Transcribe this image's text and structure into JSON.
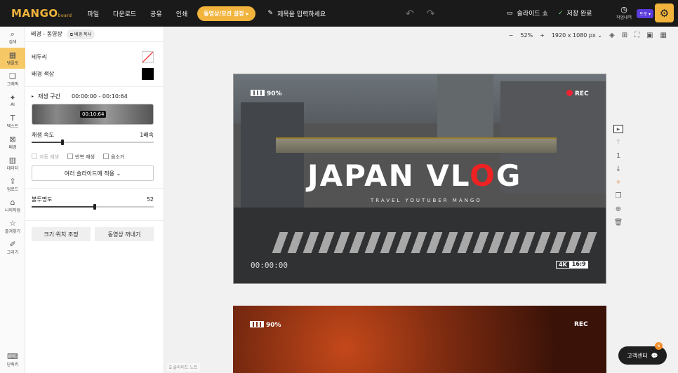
{
  "topbar": {
    "logo": "MANGO",
    "logo_sub": "board",
    "menu": [
      "파일",
      "다운로드",
      "공유",
      "인쇄"
    ],
    "motion_button": "동영상/모션 설정",
    "title_placeholder": "제목을 입력하세요",
    "slideshow": "슬라이드 쇼",
    "saved": "저장 완료",
    "history": "작업내역",
    "plan_badge": "프로"
  },
  "rail": {
    "items": [
      "검색",
      "템플릿",
      "그래픽",
      "AI",
      "텍스트",
      "배경",
      "데이터",
      "업로드",
      "나의작업",
      "즐겨찾기",
      "그리기"
    ],
    "bottom": "단축키"
  },
  "panel": {
    "breadcrumb": "배경 - 동영상",
    "duplicate": "배경 복사",
    "border_label": "테두리",
    "bg_color_label": "배경 색상",
    "playback_label": "재생 구간",
    "playback_range": "00:00:00 - 00:10:64",
    "film_timecode": "00:10:64",
    "speed_label": "재생 속도",
    "speed_value": "1배속",
    "speed_fraction": 0.25,
    "autoplay": "자동 재생",
    "repeat": "반복 재생",
    "mute": "음소거",
    "apply_multi": "여러 슬라이드에 적용",
    "opacity_label": "불투명도",
    "opacity_value": "52",
    "opacity_fraction": 0.52,
    "resize_button": "크기·위치 조정",
    "extract_button": "동영상 꺼내기"
  },
  "canvas": {
    "zoom_minus": "−",
    "zoom": "52%",
    "zoom_plus": "+",
    "size": "1920 x 1080 px",
    "slide_note": "슬라이드 노트",
    "page_number": "1"
  },
  "slide1": {
    "battery": "90%",
    "rec": "REC",
    "title_a": "JAPAN VL",
    "title_o": "O",
    "title_b": "G",
    "subtitle": "TRAVEL YOUTUBER MANGO",
    "timecode": "00:00:00",
    "res": "4K",
    "ratio": "16:9"
  },
  "slide2": {
    "battery": "90%",
    "rec": "REC"
  },
  "support": {
    "label": "고객센터",
    "count": "6"
  },
  "colors": {
    "accent": "#f2b43c",
    "topbar": "#1a1a1a",
    "rec": "#e22233"
  }
}
